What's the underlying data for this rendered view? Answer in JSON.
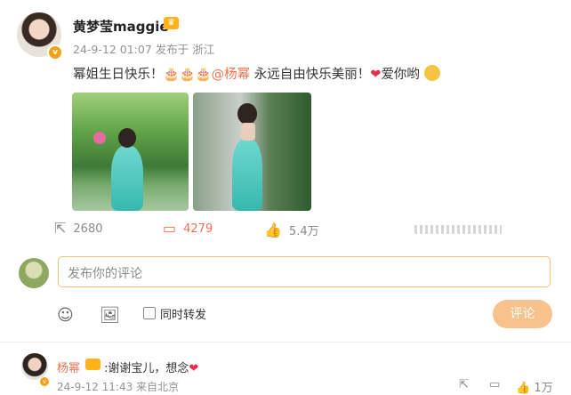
{
  "post": {
    "username": "黄梦莹maggie",
    "meta": "24-9-12 01:07 发布于 浙江",
    "text_before": "幂姐生日快乐！🎂🎂🎂",
    "mention": "@杨幂",
    "text_after": " 永远自由快乐美丽！",
    "heart": "❤",
    "text_end": "爱你哟"
  },
  "actions": {
    "repost_count": "2680",
    "comment_count": "4279",
    "like_count": "5.4万"
  },
  "composer": {
    "placeholder": "发布你的评论",
    "repost_label": "同时转发",
    "submit_label": "评论"
  },
  "reply": {
    "username": "杨幂",
    "text": ":谢谢宝儿，想念",
    "heart": "❤",
    "meta": "24-9-12 11:43 来自北京",
    "like_count": "1万"
  },
  "colors": {
    "accent": "#eb7350",
    "submit_bg": "#f8c28c",
    "badge": "#f6a018"
  },
  "icons": {
    "crown": "crown-icon",
    "repost": "share-icon",
    "comment": "comment-icon",
    "like": "thumbs-up-icon",
    "emoji": "smiley-icon",
    "image": "image-icon"
  }
}
